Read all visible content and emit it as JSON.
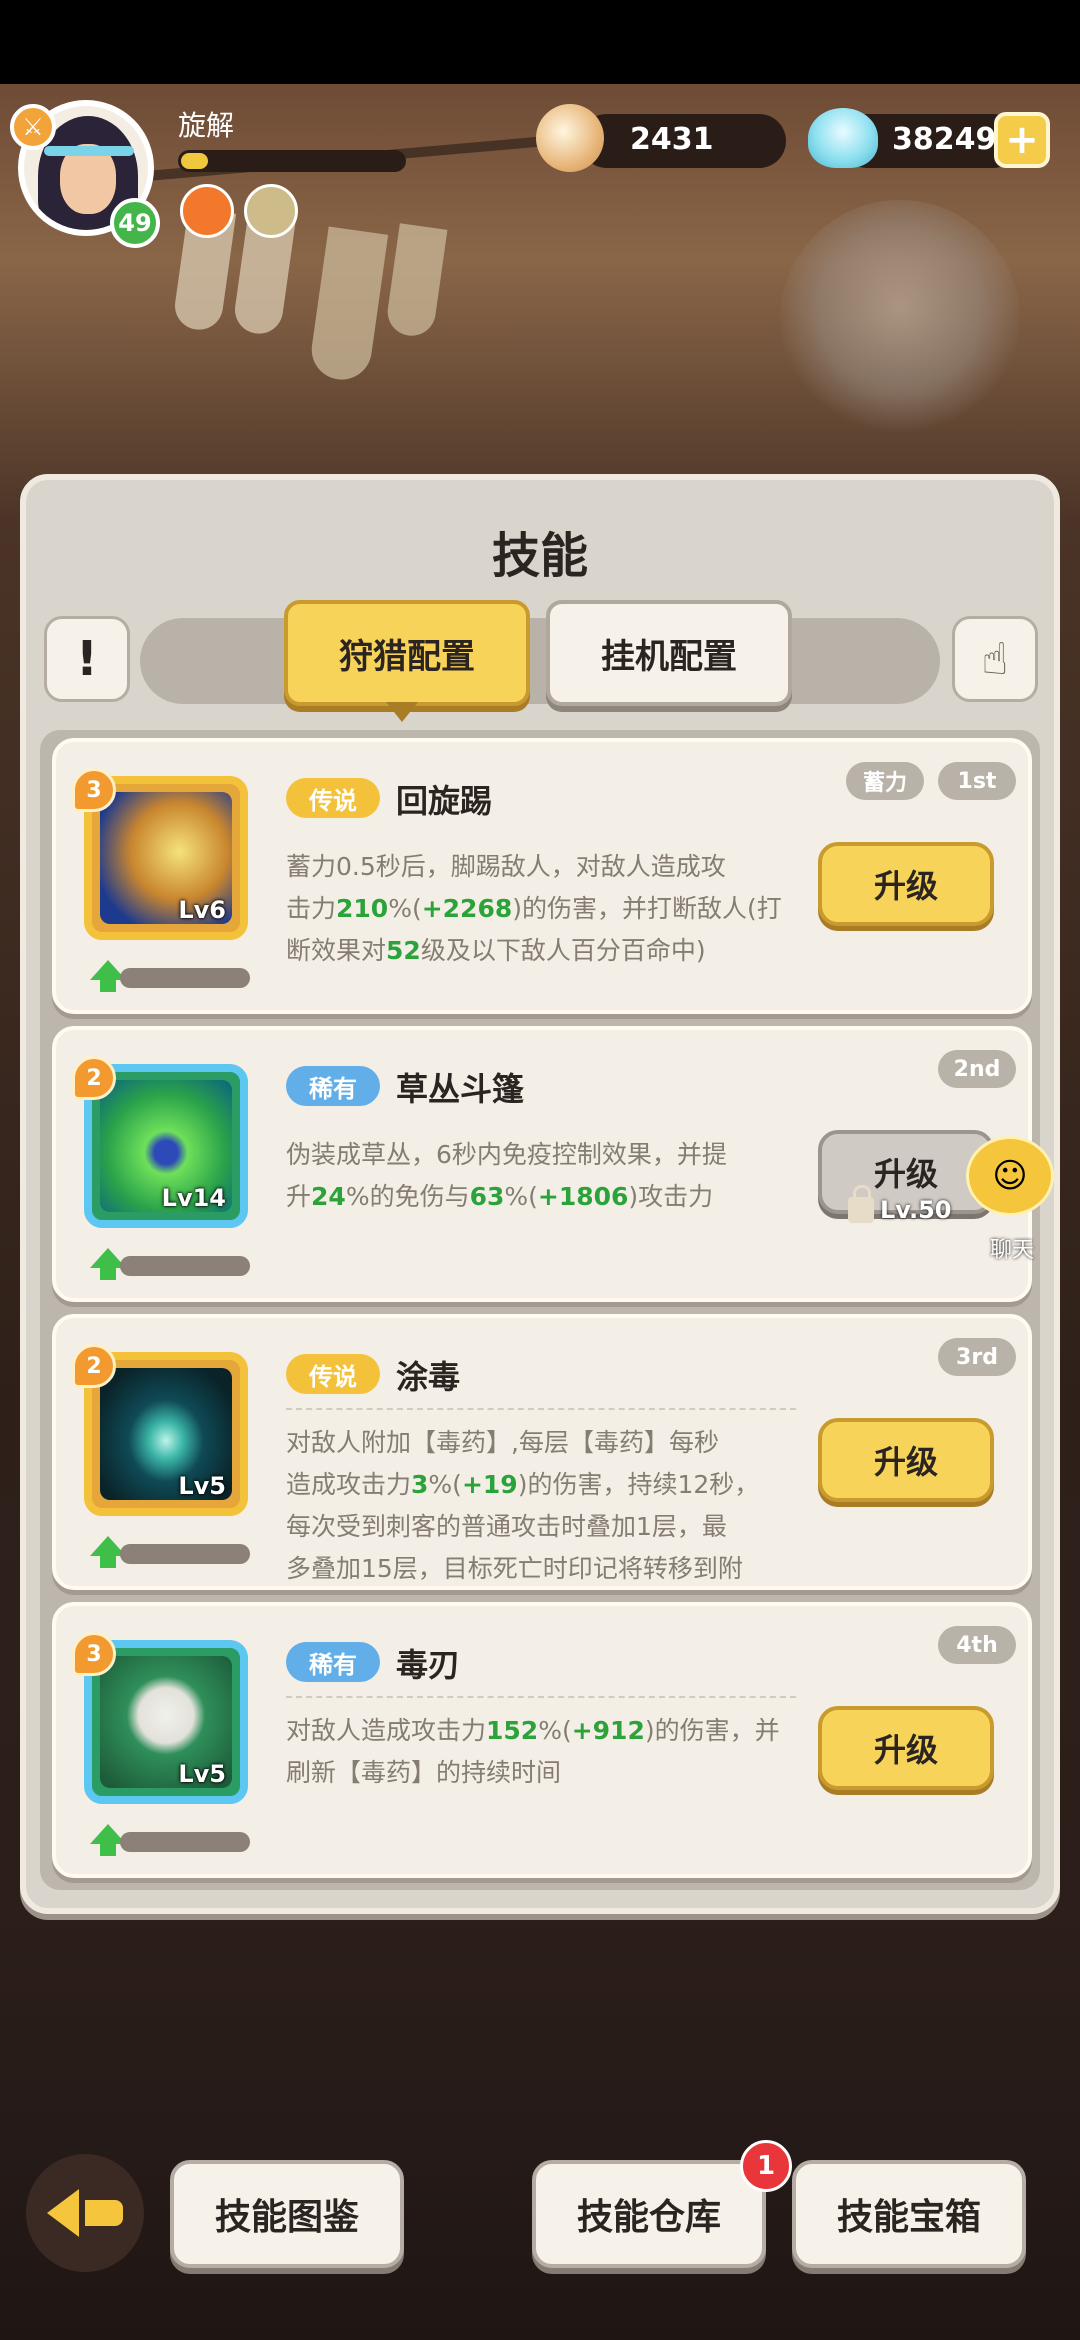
{
  "player": {
    "name": "旋解",
    "level": "49",
    "xp_progress": 0.12
  },
  "currencies": [
    {
      "icon": "pearl-shell-icon",
      "value": "2431"
    },
    {
      "icon": "blue-gem-icon",
      "value": "38249"
    }
  ],
  "panel": {
    "title": "技能",
    "info_glyph": "!",
    "tabs": [
      {
        "label": "狩猎配置",
        "active": true
      },
      {
        "label": "挂机配置",
        "active": false
      }
    ]
  },
  "skills": [
    {
      "stars": "3",
      "level": "Lv6",
      "rarity": "传说",
      "name": "回旋踢",
      "tag": "蓄力",
      "slot": "1st",
      "button": "升级",
      "locked": false
    },
    {
      "stars": "2",
      "level": "Lv14",
      "rarity": "稀有",
      "name": "草丛斗篷",
      "slot": "2nd",
      "button": "升级",
      "locked": true,
      "lock_text": "Lv.50"
    },
    {
      "stars": "2",
      "level": "Lv5",
      "rarity": "传说",
      "name": "涂毒",
      "slot": "3rd",
      "button": "升级",
      "locked": false
    },
    {
      "stars": "3",
      "level": "Lv5",
      "rarity": "稀有",
      "name": "毒刃",
      "slot": "4th",
      "button": "升级",
      "locked": false
    }
  ],
  "skill_desc": [
    [
      "蓄力0.5秒后，脚踢敌人，对敌人造成攻",
      "击力",
      "210",
      "%(",
      "+2268",
      ")的伤害，并打断敌人(打",
      "断效果对",
      "52",
      "级及以下敌人百分百命中)"
    ],
    [
      "伪装成草丛，6秒内免疫控制效果，并提",
      "升",
      "24",
      "%的免伤与",
      "63",
      "%(",
      "+1806",
      ")攻击力"
    ],
    [
      "对敌人附加【毒药】,每层【毒药】每秒",
      "造成攻击力",
      "3",
      "%(",
      "+19",
      ")的伤害，持续12秒，",
      "每次受到刺客的普通攻击时叠加1层，最",
      "多叠加15层，目标死亡时印记将转移到附"
    ],
    [
      "对敌人造成攻击力",
      "152",
      "%(",
      "+912",
      ")的伤害，并",
      "刷新【毒药】的持续时间"
    ]
  ],
  "chat": {
    "label": "聊天"
  },
  "bottom": {
    "skill_codex": "技能图鉴",
    "skill_storage": "技能仓库",
    "skill_storage_badge": "1",
    "skill_chest": "技能宝箱"
  },
  "colors": {
    "accent_yellow": "#f7d459",
    "legend": "#f3c23a",
    "rare": "#62aee8",
    "bonus_green": "#2ca33a"
  }
}
